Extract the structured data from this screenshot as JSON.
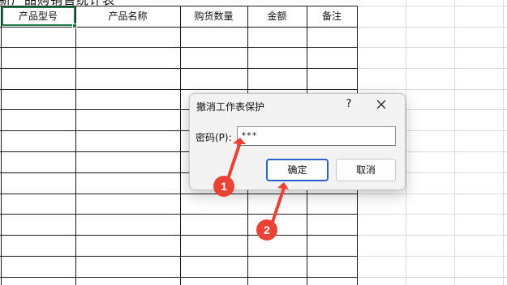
{
  "sheet": {
    "title_partial": "新产品购销售统计表",
    "headers": [
      "产品型号",
      "产品名称",
      "购货数量",
      "金额",
      "备注"
    ]
  },
  "dialog": {
    "title": "撤消工作表保护",
    "help_label": "?",
    "password_label": "密码(P):",
    "password_value": "***",
    "ok_label": "确定",
    "cancel_label": "取消"
  },
  "annotations": {
    "badge1": "1",
    "badge2": "2",
    "accent_color": "#ea4335"
  }
}
